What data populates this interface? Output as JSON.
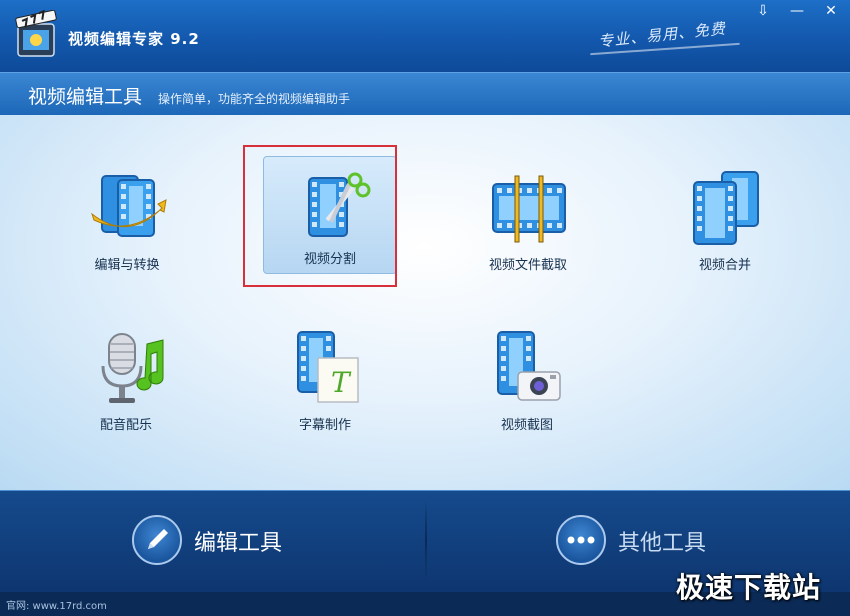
{
  "window": {
    "title": "视频编辑专家 9.2",
    "slogan": "专业、易用、免费",
    "controls": {
      "menu": "⇩",
      "minimize": "—",
      "close": "✕"
    }
  },
  "section": {
    "title": "视频编辑工具",
    "subtitle": "操作简单，功能齐全的视频编辑助手"
  },
  "tools": [
    {
      "label": "编辑与转换",
      "icon": "film-convert-icon"
    },
    {
      "label": "视频分割",
      "icon": "film-scissors-icon",
      "selected": true
    },
    {
      "label": "视频文件截取",
      "icon": "film-trim-icon"
    },
    {
      "label": "视频合并",
      "icon": "film-merge-icon"
    },
    {
      "label": "配音配乐",
      "icon": "microphone-music-icon"
    },
    {
      "label": "字幕制作",
      "icon": "film-subtitle-icon"
    },
    {
      "label": "视频截图",
      "icon": "film-camera-icon"
    }
  ],
  "bottom_tabs": [
    {
      "label": "编辑工具",
      "icon": "pencil-icon",
      "active": true
    },
    {
      "label": "其他工具",
      "icon": "more-dots-icon",
      "active": false
    }
  ],
  "status": {
    "website": "官网: www.17rd.com",
    "watermark": "极速下载站"
  },
  "colors": {
    "title_bar": "#1358ad",
    "highlight_box": "#d8303a",
    "bottom_bar": "#154a8c"
  }
}
